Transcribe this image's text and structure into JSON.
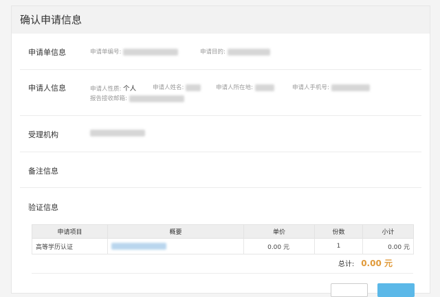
{
  "title": "确认申请信息",
  "sections": {
    "order": {
      "label": "申请单信息",
      "fields": {
        "order_no": "申请单编号:",
        "purpose": "申请目的:"
      }
    },
    "applicant": {
      "label": "申请人信息",
      "fields": {
        "type_label": "申请人性质:",
        "type_value": "个人",
        "name": "申请人姓名:",
        "location": "申请人所在地:",
        "phone": "申请人手机号:",
        "email": "报告接收邮箱:"
      }
    },
    "agency": {
      "label": "受理机构"
    },
    "remark": {
      "label": "备注信息"
    },
    "verify": {
      "label": "验证信息"
    }
  },
  "table": {
    "headers": [
      "申请项目",
      "概要",
      "单价",
      "份数",
      "小计"
    ],
    "rows": [
      {
        "item": "高等学历认证",
        "price": "0.00 元",
        "qty": "1",
        "subtotal": "0.00 元"
      }
    ],
    "total_label": "总计:",
    "total_value": "0.00 元"
  },
  "colors": {
    "accent": "#e09a3a",
    "primary": "#5bb8e8"
  }
}
